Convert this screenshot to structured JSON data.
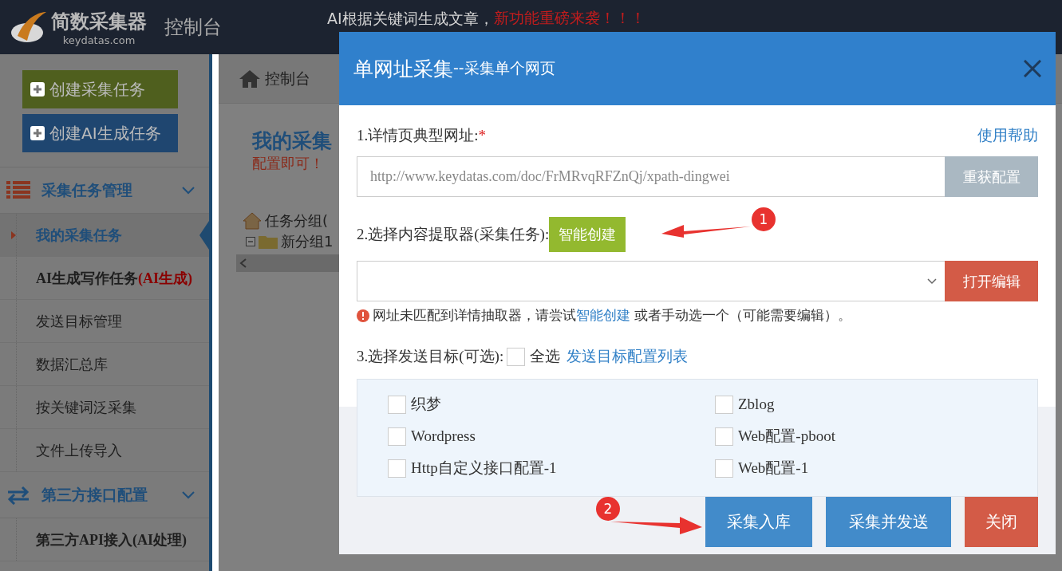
{
  "header": {
    "logo_text": "简数采集器",
    "logo_subtext": "keydatas.com",
    "title": "控制台",
    "announcement": {
      "text": "AI根据关键词生成文章，",
      "highlight": "新功能重磅来袭！！！"
    }
  },
  "sidebar": {
    "buttons": [
      {
        "label": "创建采集任务",
        "color": "#4f5f1e"
      },
      {
        "label": "创建AI生成任务",
        "color": "#1f4670"
      }
    ],
    "groups": [
      {
        "title": "采集任务管理",
        "kind": "list",
        "expanded": true,
        "items": [
          {
            "label": "我的采集任务",
            "selected": true,
            "bold": false
          },
          {
            "label": "AI生成写作任务",
            "tag": "(AI生成)",
            "selected": false,
            "bold": true
          },
          {
            "label": "发送目标管理",
            "selected": false,
            "bold": false
          },
          {
            "label": "数据汇总库",
            "selected": false,
            "bold": false
          },
          {
            "label": "按关键词泛采集",
            "selected": false,
            "bold": false
          },
          {
            "label": "文件上传导入",
            "selected": false,
            "bold": false
          }
        ]
      },
      {
        "title": "第三方接口配置",
        "kind": "swap",
        "expanded": true,
        "items": [
          {
            "label": "第三方API接入(AI处理)",
            "selected": false,
            "bold": true
          }
        ]
      }
    ]
  },
  "breadcrumb": "控制台",
  "content": {
    "heading": "我的采集",
    "subheading": "配置即可！",
    "tree": {
      "label": "任务分组(",
      "expanded": true,
      "children": [
        {
          "label": "新分组1"
        }
      ]
    }
  },
  "modal": {
    "title": "单网址采集",
    "subtitle": "--采集单个网页",
    "url_section": {
      "label": "1.详情页典型网址:",
      "required": "*",
      "help_link": "使用帮助",
      "url_placeholder": "http://www.keydatas.com/doc/FrMRvqRFZnQj/xpath-dingwei",
      "button": "重获配置"
    },
    "extractor_section": {
      "label": "2.选择内容提取器(采集任务):",
      "create_button": "智能创建",
      "open_button": "打开编辑",
      "warning": "网址未匹配到详情抽取器，请尝试",
      "warning_link": "智能创建",
      "warning_tail": " 或者手动选一个（可能需要编辑）。"
    },
    "target_section": {
      "label": "3.选择发送目标(可选):",
      "select_all": {
        "label": "全选",
        "checked": false
      },
      "link": "发送目标配置列表",
      "targets": [
        {
          "label": "织梦",
          "checked": false
        },
        {
          "label": "Zblog",
          "checked": false
        },
        {
          "label": "Wordpress",
          "checked": false
        },
        {
          "label": "Web配置-pboot",
          "checked": false
        },
        {
          "label": "Http自定义接口配置-1",
          "checked": false
        },
        {
          "label": "Web配置-1",
          "checked": false
        }
      ]
    },
    "buttons": [
      {
        "label": "采集入库",
        "kind": "primary"
      },
      {
        "label": "采集并发送",
        "kind": "primary"
      },
      {
        "label": "关闭",
        "kind": "danger"
      }
    ]
  },
  "annotations": [
    {
      "badge": "1"
    },
    {
      "badge": "2"
    }
  ]
}
